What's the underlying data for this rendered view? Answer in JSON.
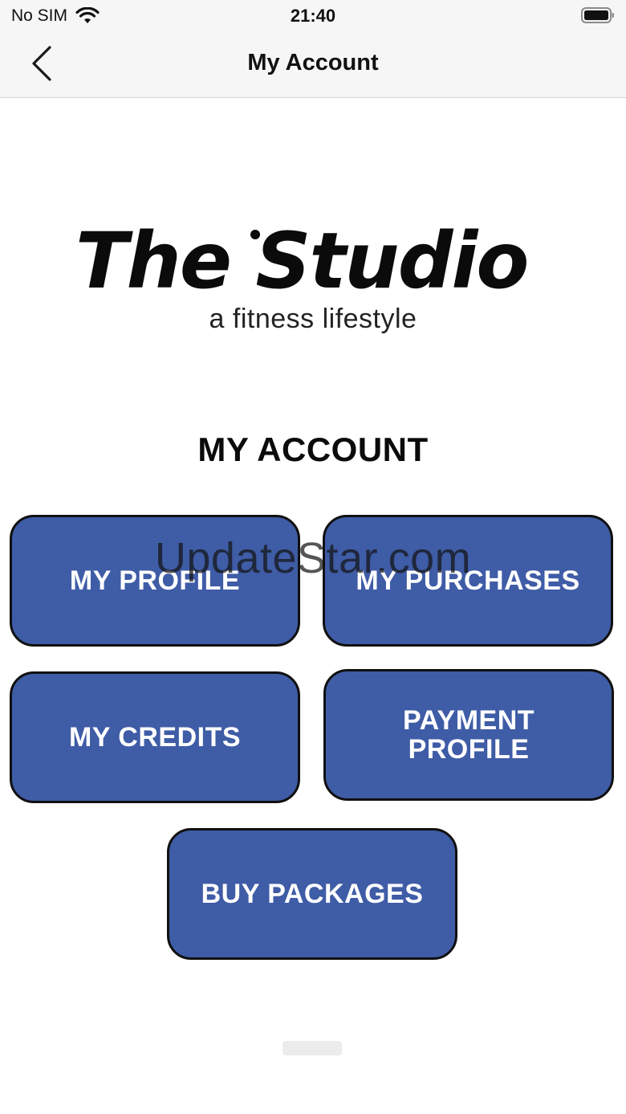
{
  "status_bar": {
    "carrier": "No SIM",
    "time": "21:40",
    "wifi_icon": "wifi-icon",
    "battery_icon": "battery-icon",
    "battery_level": 1.0
  },
  "nav": {
    "back_icon": "chevron-left-icon",
    "title": "My Account"
  },
  "logo": {
    "main_text": "The Studio",
    "tagline": "a fitness lifestyle"
  },
  "section": {
    "title": "MY ACCOUNT"
  },
  "buttons": {
    "my_profile": "MY PROFILE",
    "my_purchases": "MY PURCHASES",
    "my_credits": "MY CREDITS",
    "payment_profile_line1": "PAYMENT",
    "payment_profile_line2": "PROFILE",
    "buy_packages": "BUY PACKAGES"
  },
  "watermark": "UpdateStar.com",
  "colors": {
    "button_fill": "#3f5ca6",
    "button_border": "#101010",
    "bar_background": "#f6f6f6"
  }
}
